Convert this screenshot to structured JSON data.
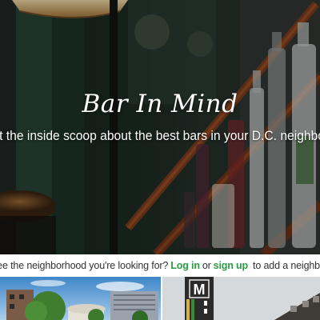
{
  "hero": {
    "title": "Bar In Mind",
    "subtitle": "et the inside scoop about the best bars in your D.C. neighborho"
  },
  "notice": {
    "prefix": "Don't see the neighborhood you're looking for?",
    "login_label": "Log in",
    "or_text": "or",
    "signup_label": "sign up",
    "suffix": "to add a neighborhood."
  },
  "colors": {
    "link": "#2e9a45",
    "metro_sign": "#2b2b2b"
  },
  "cards": [
    {
      "image": "city-skyline-photo"
    },
    {
      "image": "metro-station-photo",
      "sign_letter": "M"
    }
  ]
}
